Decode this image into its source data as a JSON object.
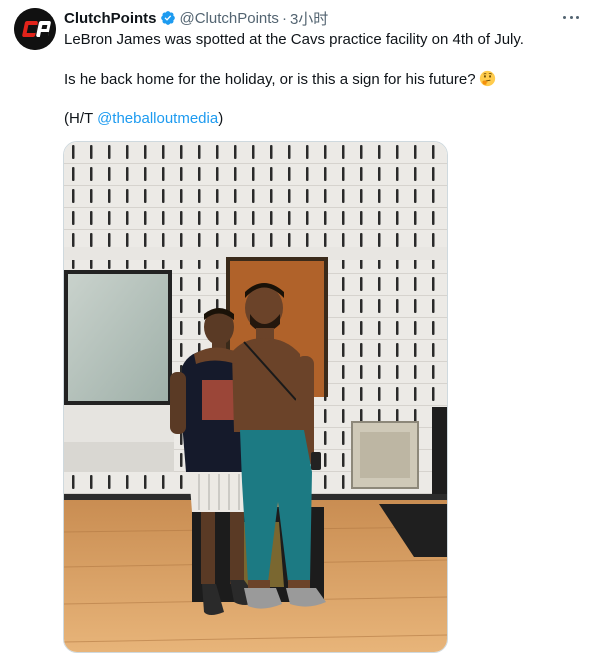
{
  "account": {
    "avatar_text": "CP",
    "display_name": "ClutchPoints",
    "handle": "@ClutchPoints",
    "separator": "·",
    "time": "3小时",
    "verified": true
  },
  "icons": {
    "verified": "verified-badge-icon",
    "more": "more-horizontal-icon",
    "emoji": "thinking-face-emoji"
  },
  "tweet": {
    "line1": "LeBron James was spotted at the Cavs practice facility on 4th of July.",
    "line2": "Is he back home for the holiday, or is this a sign for his future?",
    "credit_prefix": "(H/T ",
    "mention": "@theballoutmedia",
    "credit_suffix": ")"
  },
  "media": {
    "alt": "Two people standing in a gym with white walls and a wooden floor"
  },
  "colors": {
    "accent": "#1d9bf0",
    "text": "#0f1419",
    "secondary": "#536471",
    "avatar_bg": "#111111",
    "avatar_red": "#e2231a"
  }
}
